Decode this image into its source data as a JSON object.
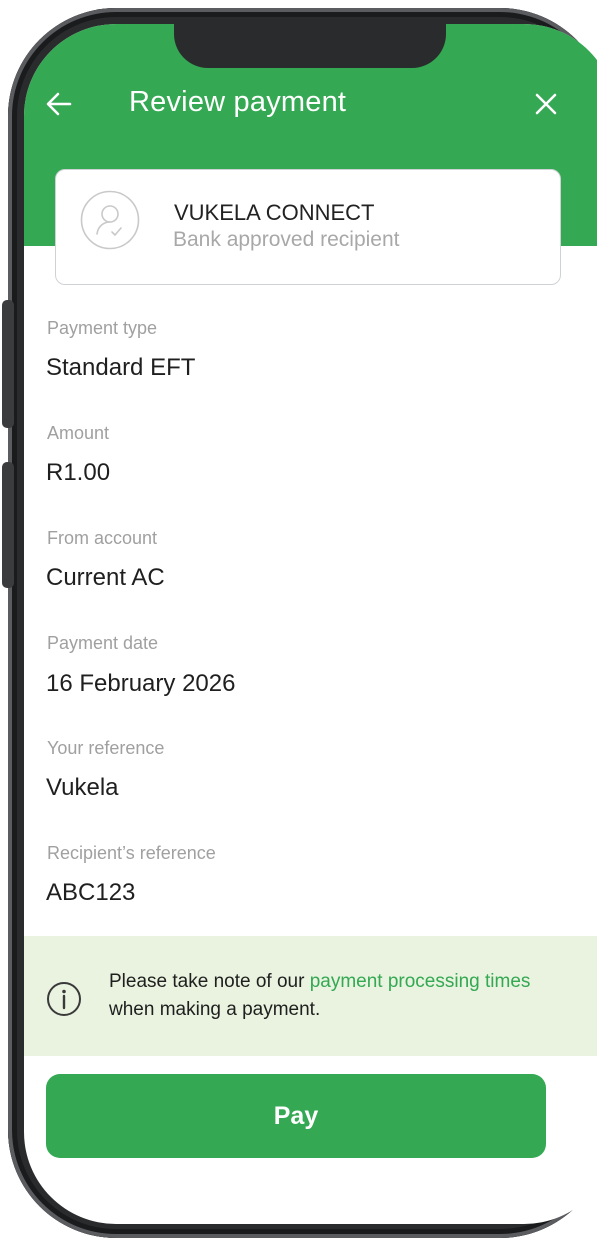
{
  "header": {
    "title": "Review payment",
    "back_icon": "arrow-left-icon",
    "close_icon": "close-icon",
    "bg_color": "#34a853"
  },
  "recipient": {
    "name": "VUKELA CONNECT",
    "subtitle": "Bank approved recipient",
    "icon": "verified-user-icon"
  },
  "fields": [
    {
      "label": "Payment type",
      "value": "Standard EFT"
    },
    {
      "label": "Amount",
      "value": "R1.00"
    },
    {
      "label": "From account",
      "value": "Current AC"
    },
    {
      "label": "Payment date",
      "value": "16 February 2026"
    },
    {
      "label": "Your reference",
      "value": "Vukela"
    },
    {
      "label": "Recipient’s reference",
      "value": "ABC123"
    }
  ],
  "notice": {
    "icon": "info-icon",
    "text_before": "Please take note of our ",
    "link_text": "payment processing times",
    "text_after": " when making a payment.",
    "bg_color": "#e9f3df"
  },
  "pay_button": {
    "label": "Pay",
    "color": "#34a853"
  }
}
